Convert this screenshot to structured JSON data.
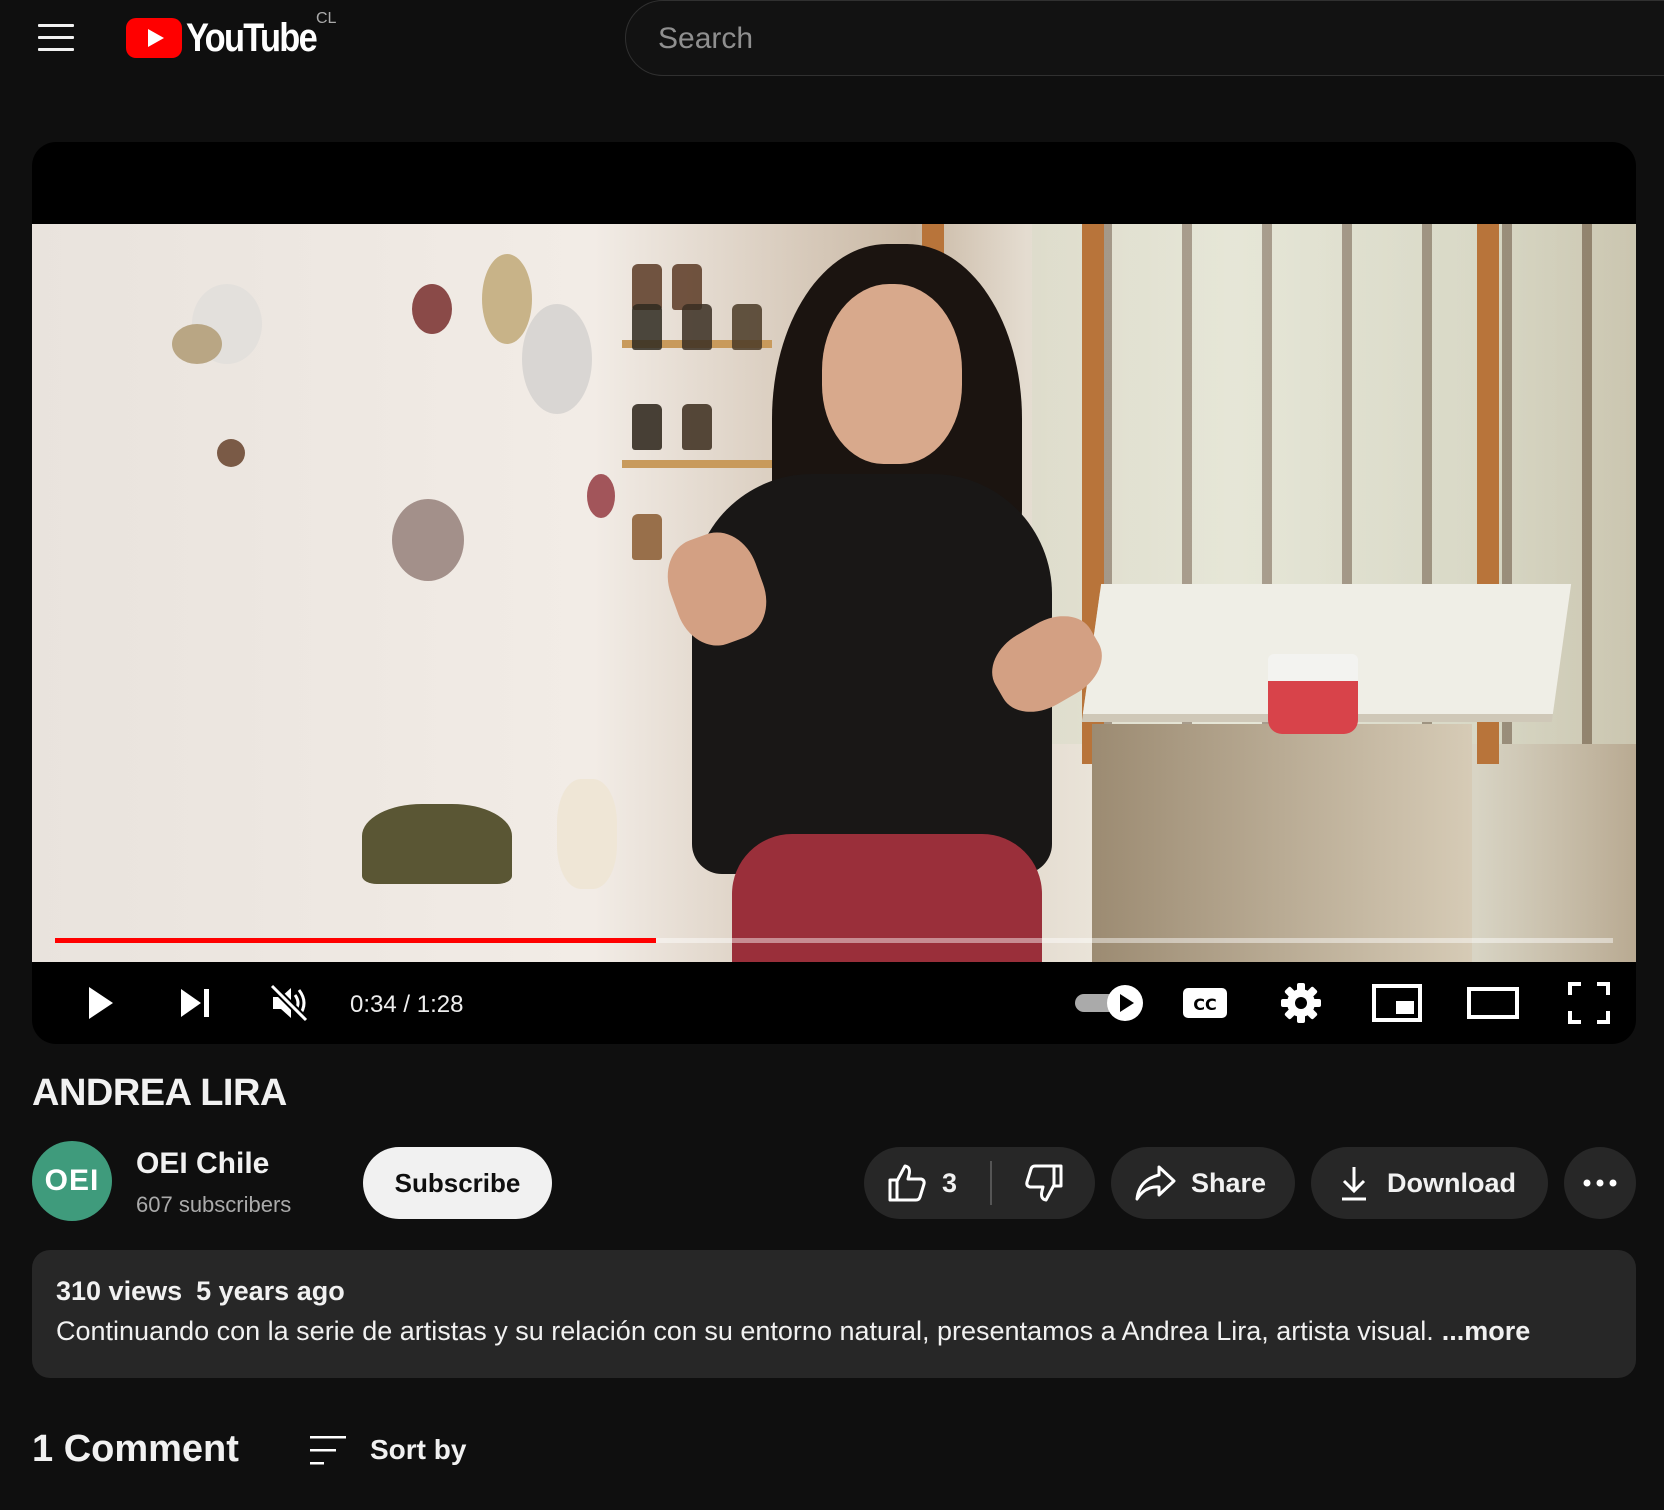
{
  "header": {
    "logo_text": "YouTube",
    "country_code": "CL",
    "search_placeholder": "Search"
  },
  "player": {
    "current_time": "0:34",
    "duration": "1:28",
    "time_display": "0:34 / 1:28",
    "progress_fraction": 0.386,
    "muted": true,
    "autoplay_on": true
  },
  "video": {
    "title": "ANDREA LIRA"
  },
  "channel": {
    "avatar_text": "OEI",
    "avatar_color": "#3f9b7c",
    "name": "OEI Chile",
    "subscribers": "607 subscribers",
    "subscribe_label": "Subscribe"
  },
  "actions": {
    "like_count": "3",
    "share_label": "Share",
    "download_label": "Download"
  },
  "description": {
    "views": "310 views",
    "age": "5 years ago",
    "text": "Continuando con la serie de artistas y su relación con su entorno natural, presentamos a Andrea Lira, artista visual.",
    "more_label": "...more"
  },
  "comments": {
    "count_label": "1 Comment",
    "sort_label": "Sort by"
  },
  "colors": {
    "background": "#0f0f0f",
    "pill": "#272727",
    "progress": "#ff0000",
    "brand_red": "#ff0000"
  }
}
